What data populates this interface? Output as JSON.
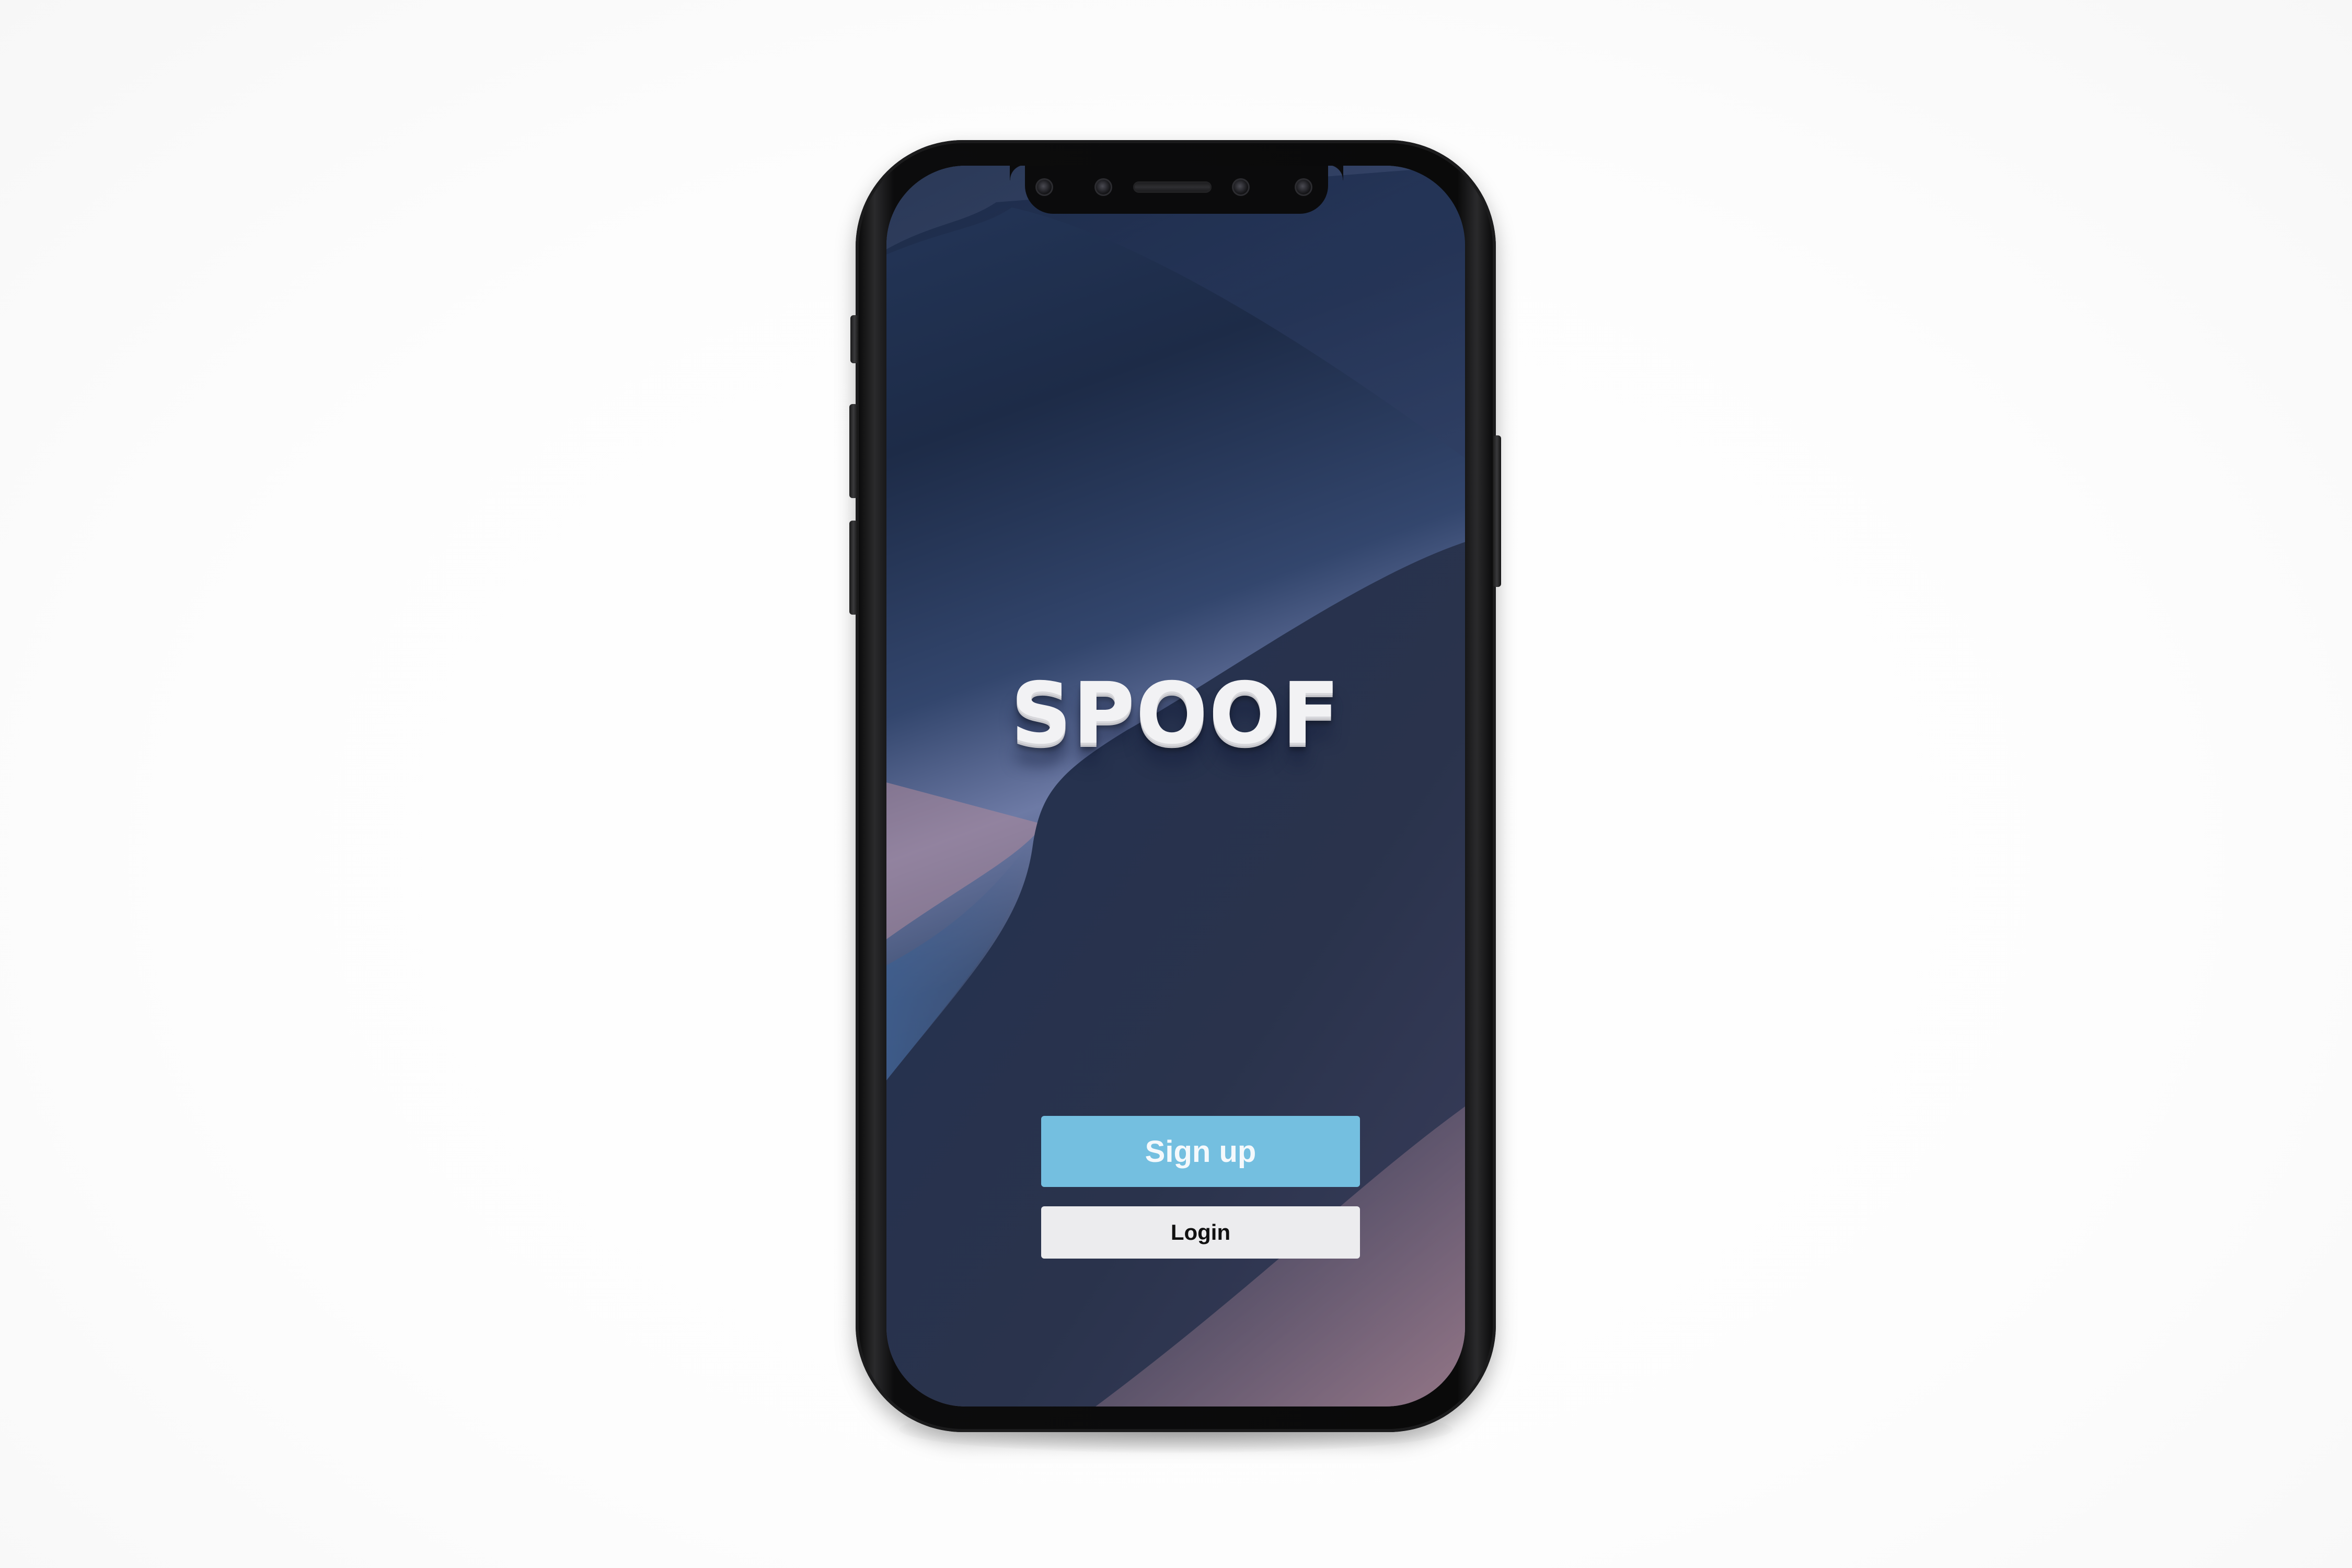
{
  "app": {
    "title": "SPOOF"
  },
  "actions": {
    "signup_label": "Sign up",
    "login_label": "Login"
  },
  "colors": {
    "signup_button": "#74bfe0",
    "login_button": "#ececee",
    "phone_body": "#0a0a0a",
    "background": "#ffffff"
  }
}
